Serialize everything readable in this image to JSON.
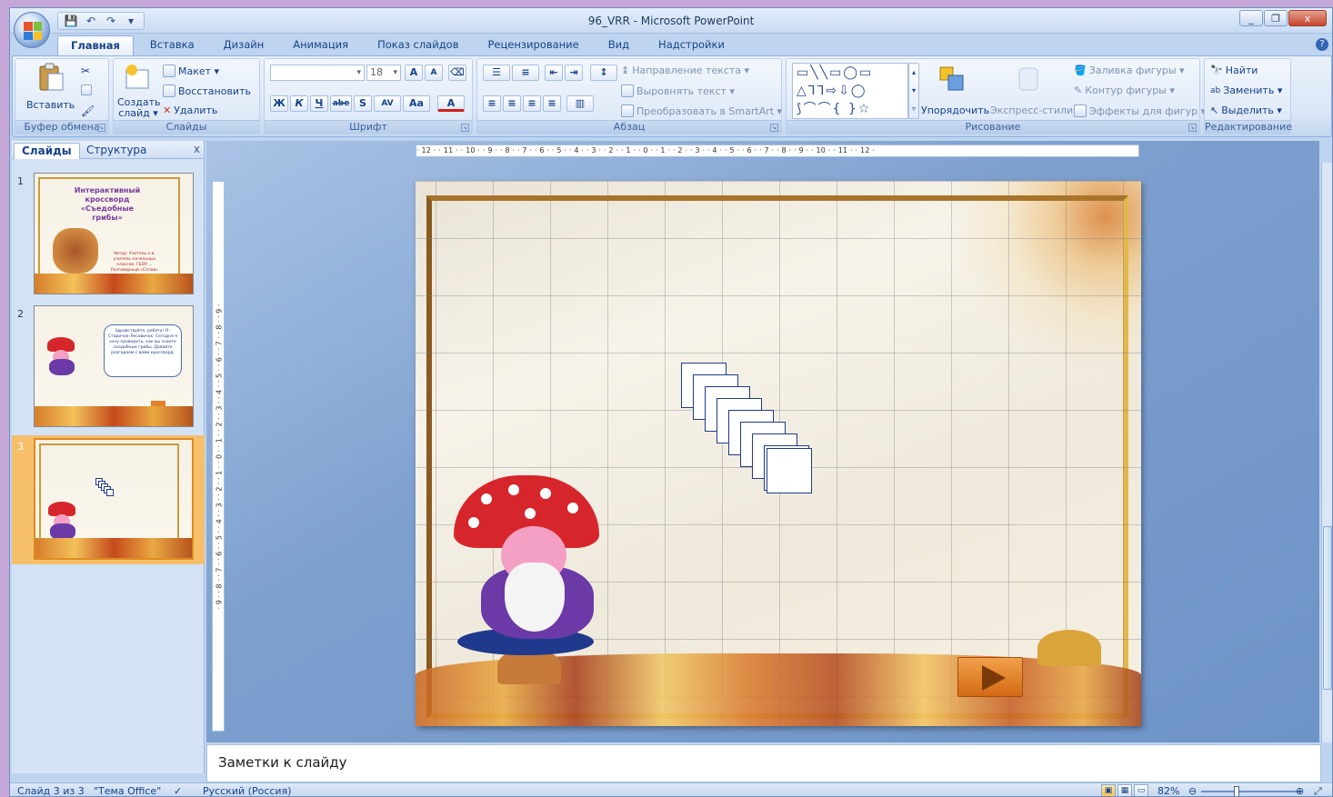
{
  "window": {
    "title": "96_VRR - Microsoft PowerPoint",
    "controls": [
      "_",
      "❐",
      "x"
    ]
  },
  "qat": {
    "save": "💾",
    "undo": "↶",
    "redo": "↷",
    "more": "▾"
  },
  "tabs": [
    {
      "label": "Главная",
      "active": true
    },
    {
      "label": "Вставка"
    },
    {
      "label": "Дизайн"
    },
    {
      "label": "Анимация"
    },
    {
      "label": "Показ слайдов"
    },
    {
      "label": "Рецензирование"
    },
    {
      "label": "Вид"
    },
    {
      "label": "Надстройки"
    }
  ],
  "ribbon": {
    "clipboard": {
      "label": "Буфер обмена",
      "paste": "Вставить"
    },
    "slides": {
      "label": "Слайды",
      "new_slide": "Создать слайд ▾",
      "layout": "Макет ▾",
      "reset": "Восстановить",
      "delete": "Удалить"
    },
    "font": {
      "label": "Шрифт",
      "font_name": "",
      "font_size": "18",
      "grow": "A",
      "shrink": "A",
      "bold": "Ж",
      "italic": "К",
      "underline": "Ч",
      "strike": "abe",
      "shadow": "S",
      "spacing": "AV",
      "case": "Aa",
      "color": "A"
    },
    "paragraph": {
      "label": "Абзац",
      "text_direction": "Направление текста ▾",
      "align_text": "Выровнять текст ▾",
      "smartart": "Преобразовать в SmartArt ▾"
    },
    "drawing": {
      "label": "Рисование",
      "arrange": "Упорядочить",
      "quick_styles": "Экспресс-стили",
      "fill": "Заливка фигуры ▾",
      "outline": "Контур фигуры ▾",
      "effects": "Эффекты для фигур ▾"
    },
    "editing": {
      "label": "Редактирование",
      "find": "Найти",
      "replace": "Заменить ▾",
      "select": "Выделить ▾"
    }
  },
  "panel": {
    "tab_slides": "Слайды",
    "tab_outline": "Структура",
    "close": "x",
    "slides": [
      {
        "num": "1",
        "title": "Интерактивный кроссворд «Съедобные грибы»",
        "subtitle": "Автор: Учитель н.в. учитель начальных классов. ГБОУ ... Разговорный «Сплав»"
      },
      {
        "num": "2",
        "bubble": "Здравствуйте, ребята! Я - Старичок-Лесовичок. Сегодня я хочу проверить, как вы знаете съедобные грибы. Давайте разгадаем с вами кроссворд."
      },
      {
        "num": "3",
        "selected": true
      }
    ]
  },
  "ruler": {
    "horizontal": "· 12 · · 11 · · 10 · · 9 · · 8 · · 7 · · 6 · · 5 · · 4 · · 3 · · 2 · · 1 · · 0 · · 1 · · 2 · · 3 · · 4 · · 5 · · 6 · · 7 · · 8 · · 9 · · 10 · · 11 · · 12 ·",
    "vertical": "· 9 · · 8 · · 7 · · 6 · · 5 · · 4 · · 3 · · 2 · · 1 · · 0 · · 1 · · 2 · · 3 · · 4 · · 5 · · 6 · · 7 · · 8 · · 9 ·"
  },
  "notes": {
    "placeholder": "Заметки к слайду"
  },
  "status": {
    "slide": "Слайд 3 из 3",
    "theme": "\"Тема Office\"",
    "language": "Русский (Россия)",
    "zoom": "82%"
  }
}
